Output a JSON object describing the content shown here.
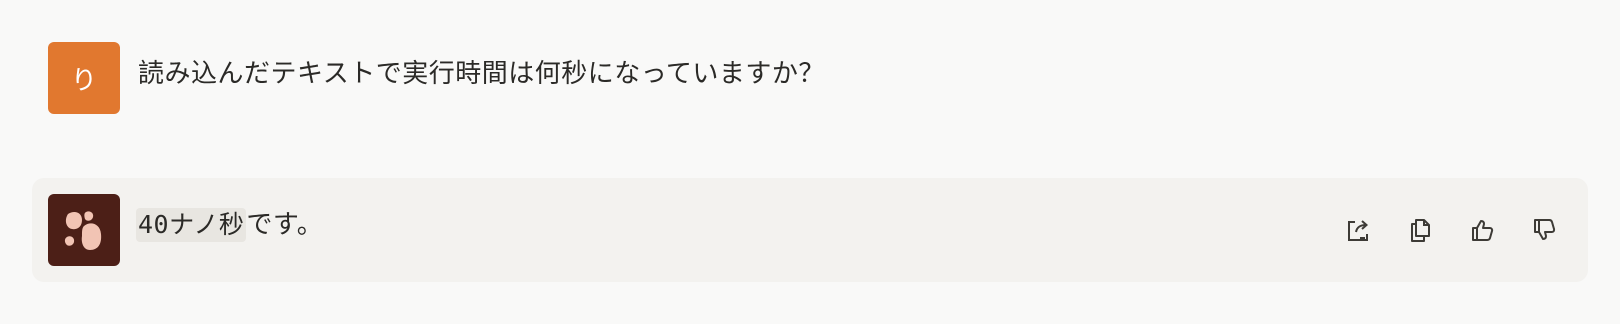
{
  "user_message": {
    "avatar_initial": "り",
    "avatar_color": "#e1782f",
    "text": "読み込んだテキストで実行時間は何秒になっていますか？"
  },
  "assistant_message": {
    "avatar_color": "#4c1f17",
    "code_text": "40ナノ秒",
    "suffix_text": "です。",
    "actions": [
      {
        "icon": "share-icon"
      },
      {
        "icon": "copy-icon"
      },
      {
        "icon": "thumbs-up-icon"
      },
      {
        "icon": "thumbs-down-icon"
      }
    ]
  }
}
